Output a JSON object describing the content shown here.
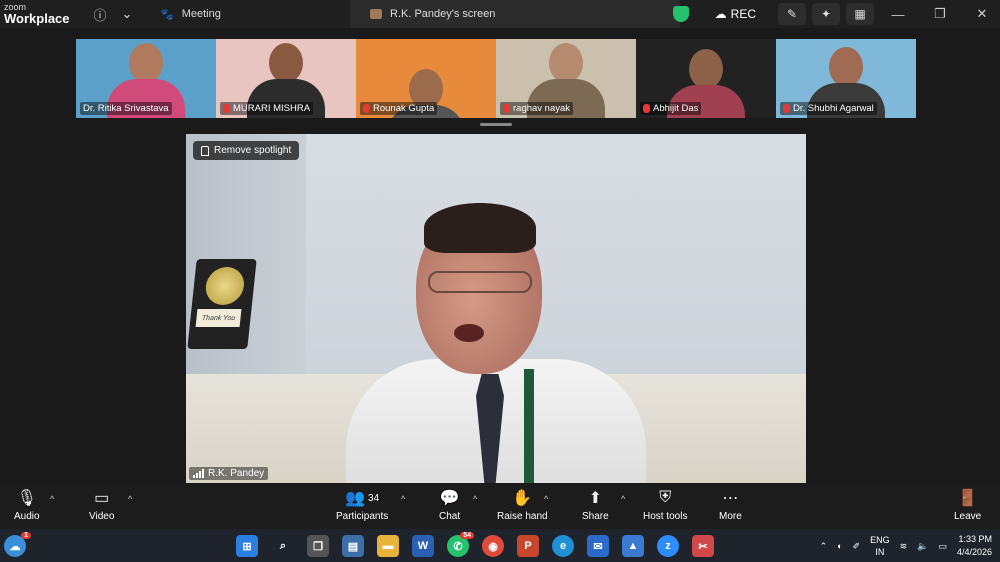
{
  "app": {
    "brand_top": "zoom",
    "brand_bottom": "Workplace"
  },
  "tabs": {
    "meeting": "Meeting",
    "screen": "R.K. Pandey's screen"
  },
  "top_tools": {
    "rec_label": "REC"
  },
  "participants_strip": [
    {
      "name": "Dr. Ritika Srivastava",
      "muted": false,
      "bg": "#5aa0c8",
      "skin": "#b07a5e",
      "shirt": "#d14b7a"
    },
    {
      "name": "MURARI MISHRA",
      "muted": true,
      "bg": "#e9c5c2",
      "skin": "#8a5a40",
      "shirt": "#2c2c2c"
    },
    {
      "name": "Rounak Gupta",
      "muted": true,
      "bg": "#e88a3c",
      "skin": "#9b6b4b",
      "shirt": "#555555"
    },
    {
      "name": "raghav nayak",
      "muted": true,
      "bg": "#cbbfae",
      "skin": "#b58a6e",
      "shirt": "#7c6a55"
    },
    {
      "name": "Abhijit Das",
      "muted": true,
      "bg": "#222222",
      "skin": "#8d6048",
      "shirt": "#a04050"
    },
    {
      "name": "Dr. Shubhi Agarwal",
      "muted": true,
      "bg": "#7fb8d8",
      "skin": "#a06b52",
      "shirt": "#3a3a3a"
    }
  ],
  "spotlight": {
    "remove_label": "Remove spotlight",
    "speaker_name": "R.K. Pandey",
    "plaque_text": "Thank You"
  },
  "toolbar": {
    "audio": "Audio",
    "video": "Video",
    "participants": "Participants",
    "participants_count": "34",
    "chat": "Chat",
    "raise_hand": "Raise hand",
    "share": "Share",
    "host_tools": "Host tools",
    "more": "More",
    "leave": "Leave"
  },
  "taskbar": {
    "weather_badge": "1",
    "whatsapp_badge": "54",
    "language_top": "ENG",
    "language_bottom": "IN",
    "time": "1:33 PM",
    "date": "4/4/2026"
  }
}
